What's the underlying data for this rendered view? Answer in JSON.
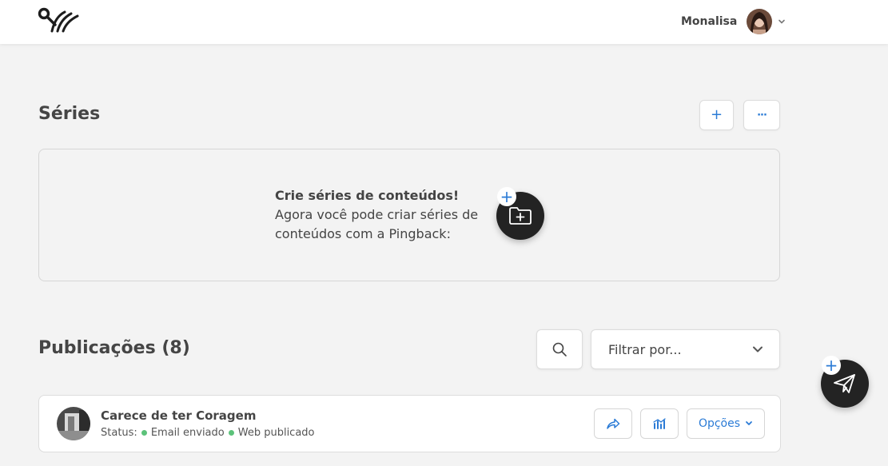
{
  "header": {
    "logo_icon": "pingback-logo-icon",
    "user_name": "Monalisa",
    "avatar_icon": "user-avatar",
    "menu_icon": "chevron-down-icon"
  },
  "series": {
    "title": "Séries",
    "add_icon_glyph": "+",
    "more_icon_glyph": "···",
    "empty_state": {
      "heading": "Crie séries de conteúdos!",
      "body": "Agora você pode criar séries de conteúdos com a Pingback:",
      "button_icon": "folder-plus-icon",
      "badge_glyph": "+"
    }
  },
  "publications": {
    "title": "Publicações (8)",
    "search_icon": "search-icon",
    "filter": {
      "selected": "Filtrar por...",
      "icon": "chevron-down-icon"
    },
    "items": [
      {
        "title": "Carece de ter Coragem",
        "status_label": "Status:",
        "statuses": [
          "Email enviado",
          "Web publicado"
        ],
        "options_label": "Opções"
      }
    ]
  },
  "fab": {
    "icon": "paper-plane-icon",
    "badge_glyph": "+"
  },
  "colors": {
    "accent": "#2b7bd6",
    "dark": "#232323",
    "status_green": "#5cc27a",
    "background": "#f3f3f3"
  }
}
